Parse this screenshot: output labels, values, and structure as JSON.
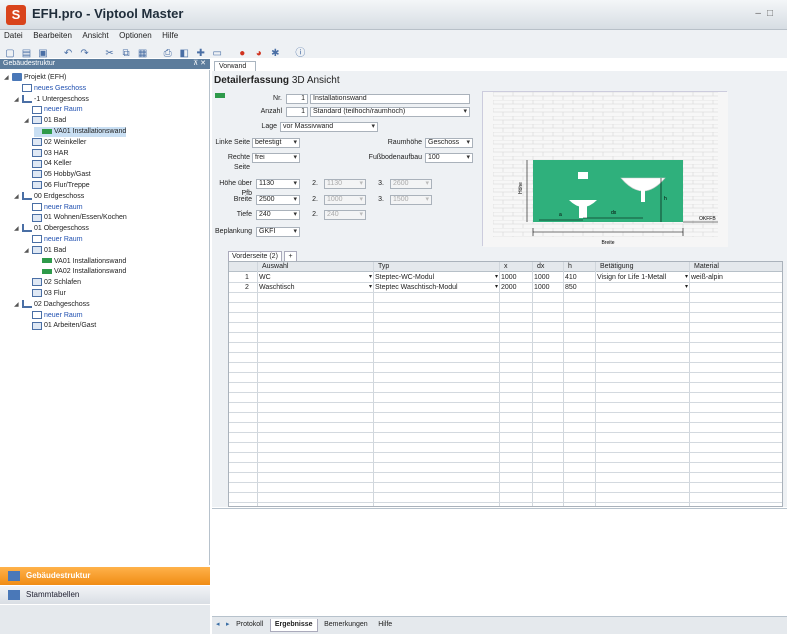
{
  "app": {
    "title": "EFH.pro - Viptool Master"
  },
  "menu": [
    "Datei",
    "Bearbeiten",
    "Ansicht",
    "Optionen",
    "Hilfe"
  ],
  "toolbar_icons": [
    "new-icon",
    "open-icon",
    "save-icon",
    "undo-icon",
    "redo-icon",
    "cut-icon",
    "copy-icon",
    "paste-icon",
    "print-icon",
    "preview-icon",
    "add-icon",
    "remove-icon",
    "red-icon-1",
    "red-icon-2",
    "settings-icon",
    "info-icon"
  ],
  "left_panel": {
    "title": "Gebäudestruktur",
    "pin": "⊼ ✕"
  },
  "tree": [
    {
      "label": "Projekt (EFH)",
      "depth": 0,
      "icon": "project",
      "exp": "◢"
    },
    {
      "label": "neues Geschoss",
      "depth": 1,
      "icon": "new",
      "link": true
    },
    {
      "label": "-1 Untergeschoss",
      "depth": 1,
      "icon": "floor",
      "exp": "◢"
    },
    {
      "label": "neuer Raum",
      "depth": 2,
      "icon": "new",
      "link": true
    },
    {
      "label": "01 Bad",
      "depth": 2,
      "icon": "room",
      "exp": "◢"
    },
    {
      "label": "VA01 Installationswand",
      "depth": 3,
      "icon": "wall",
      "sel": true
    },
    {
      "label": "02 Weinkeller",
      "depth": 2,
      "icon": "room"
    },
    {
      "label": "03 HAR",
      "depth": 2,
      "icon": "room"
    },
    {
      "label": "04 Keller",
      "depth": 2,
      "icon": "room"
    },
    {
      "label": "05 Hobby/Gast",
      "depth": 2,
      "icon": "room"
    },
    {
      "label": "06 Flur/Treppe",
      "depth": 2,
      "icon": "room"
    },
    {
      "label": "00 Erdgeschoss",
      "depth": 1,
      "icon": "floor",
      "exp": "◢"
    },
    {
      "label": "neuer Raum",
      "depth": 2,
      "icon": "new",
      "link": true
    },
    {
      "label": "01 Wohnen/Essen/Kochen",
      "depth": 2,
      "icon": "room"
    },
    {
      "label": "01 Obergeschoss",
      "depth": 1,
      "icon": "floor",
      "exp": "◢"
    },
    {
      "label": "neuer Raum",
      "depth": 2,
      "icon": "new",
      "link": true
    },
    {
      "label": "01 Bad",
      "depth": 2,
      "icon": "room",
      "exp": "◢"
    },
    {
      "label": "VA01 Installationswand",
      "depth": 3,
      "icon": "wall"
    },
    {
      "label": "VA02 Installationswand",
      "depth": 3,
      "icon": "wall"
    },
    {
      "label": "02 Schlafen",
      "depth": 2,
      "icon": "room"
    },
    {
      "label": "03 Flur",
      "depth": 2,
      "icon": "room"
    },
    {
      "label": "02 Dachgeschoss",
      "depth": 1,
      "icon": "floor",
      "exp": "◢"
    },
    {
      "label": "neuer Raum",
      "depth": 2,
      "icon": "new",
      "link": true
    },
    {
      "label": "01 Arbeiten/Gast",
      "depth": 2,
      "icon": "room"
    }
  ],
  "nav": {
    "struct": "Gebäudestruktur",
    "tables": "Stammtabellen"
  },
  "doc_tab": "Vorwand",
  "detail": {
    "title": "Detailerfassung",
    "view": "3D Ansicht"
  },
  "form": {
    "nr_label": "Nr.",
    "nr_value": "1",
    "name_value": "Installationswand",
    "anzahl_label": "Anzahl",
    "anzahl_value": "1",
    "typ_value": "Standard (teilhoch/raumhoch)",
    "lage_label": "Lage",
    "lage_value": "vor Massivwand",
    "linke_label": "Linke Seite",
    "linke_value": "befestigt",
    "raumhoehe_label": "Raumhöhe",
    "raumhoehe_value": "Geschoss",
    "rechte_label": "Rechte Seite",
    "rechte_value": "frei",
    "fussboden_label": "Fußbodenaufbau",
    "fussboden_value": "100",
    "hoehe_label": "Höhe über Pfb",
    "hoehe_value": "1130",
    "breite_label": "Breite",
    "breite_value": "2500",
    "tiefe_label": "Tiefe",
    "tiefe_value": "240",
    "beplankung_label": "Beplankung",
    "beplankung_value": "GKFI",
    "n2": "2.",
    "n3": "3.",
    "h2": "1130",
    "h3": "2600",
    "b2": "1000",
    "b3": "1500",
    "t2": "240"
  },
  "diagram": {
    "breite": "Breite",
    "hoehe": "Höhe",
    "a": "a",
    "dx": "dx",
    "h": "h",
    "okffb": "OKFFB"
  },
  "subtabs": [
    "Vorderseite (2)",
    "+"
  ],
  "grid": {
    "headers": [
      "Auswahl",
      "Typ",
      "x",
      "dx",
      "h",
      "Betätigung",
      "Material"
    ],
    "rows": [
      {
        "nr": "1",
        "auswahl": "WC",
        "typ": "Steptec-WC-Modul",
        "x": "1000",
        "dx": "1000",
        "h": "410",
        "bet": "Visign for Life 1-Metall",
        "mat": "weiß-alpin"
      },
      {
        "nr": "2",
        "auswahl": "Waschtisch",
        "typ": "Steptec Waschtisch-Modul",
        "x": "2000",
        "dx": "1000",
        "h": "850",
        "bet": "",
        "mat": ""
      }
    ]
  },
  "bottom_tabs": [
    "Protokoll",
    "Ergebnisse",
    "Bemerkungen",
    "Hilfe"
  ],
  "bottom_nav": [
    "◂",
    "▸"
  ],
  "colors": {
    "accent": "#f08c14",
    "wall_green": "#2e9a4a",
    "diagram_green": "#2fb07c"
  }
}
